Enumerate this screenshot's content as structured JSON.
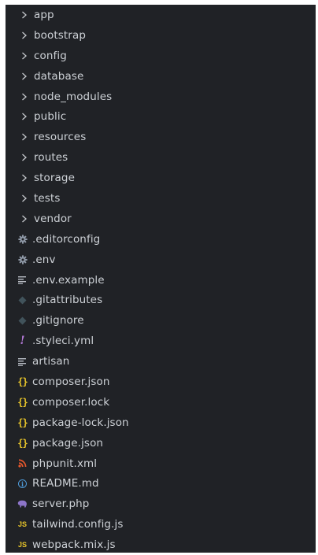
{
  "explorer": {
    "items": [
      {
        "label": "app",
        "kind": "folder",
        "icon": "chevron-right-icon"
      },
      {
        "label": "bootstrap",
        "kind": "folder",
        "icon": "chevron-right-icon"
      },
      {
        "label": "config",
        "kind": "folder",
        "icon": "chevron-right-icon"
      },
      {
        "label": "database",
        "kind": "folder",
        "icon": "chevron-right-icon"
      },
      {
        "label": "node_modules",
        "kind": "folder",
        "icon": "chevron-right-icon"
      },
      {
        "label": "public",
        "kind": "folder",
        "icon": "chevron-right-icon"
      },
      {
        "label": "resources",
        "kind": "folder",
        "icon": "chevron-right-icon"
      },
      {
        "label": "routes",
        "kind": "folder",
        "icon": "chevron-right-icon"
      },
      {
        "label": "storage",
        "kind": "folder",
        "icon": "chevron-right-icon"
      },
      {
        "label": "tests",
        "kind": "folder",
        "icon": "chevron-right-icon"
      },
      {
        "label": "vendor",
        "kind": "folder",
        "icon": "chevron-right-icon"
      },
      {
        "label": ".editorconfig",
        "kind": "file",
        "icon": "gear-icon"
      },
      {
        "label": ".env",
        "kind": "file",
        "icon": "gear-icon"
      },
      {
        "label": ".env.example",
        "kind": "file",
        "icon": "text-lines-icon"
      },
      {
        "label": ".gitattributes",
        "kind": "file",
        "icon": "git-diamond-icon"
      },
      {
        "label": ".gitignore",
        "kind": "file",
        "icon": "git-diamond-icon"
      },
      {
        "label": ".styleci.yml",
        "kind": "file",
        "icon": "yaml-exclamation-icon"
      },
      {
        "label": "artisan",
        "kind": "file",
        "icon": "text-lines-icon"
      },
      {
        "label": "composer.json",
        "kind": "file",
        "icon": "json-braces-icon"
      },
      {
        "label": "composer.lock",
        "kind": "file",
        "icon": "json-braces-icon"
      },
      {
        "label": "package-lock.json",
        "kind": "file",
        "icon": "json-braces-icon"
      },
      {
        "label": "package.json",
        "kind": "file",
        "icon": "json-braces-icon"
      },
      {
        "label": "phpunit.xml",
        "kind": "file",
        "icon": "rss-xml-icon"
      },
      {
        "label": "README.md",
        "kind": "file",
        "icon": "info-icon"
      },
      {
        "label": "server.php",
        "kind": "file",
        "icon": "php-elephant-icon"
      },
      {
        "label": "tailwind.config.js",
        "kind": "file",
        "icon": "js-icon"
      },
      {
        "label": "webpack.mix.js",
        "kind": "file",
        "icon": "js-icon"
      }
    ]
  },
  "colors": {
    "background": "#202226",
    "text": "#cdd1d6",
    "chevron": "#c5c8cc",
    "gear": "#8e98a6",
    "text-lines": "#b9bec5",
    "git-diamond": "#41535b",
    "yaml": "#b57ad9",
    "json": "#e8c52a",
    "xml": "#e8582c",
    "info": "#4f9bd9",
    "php": "#8d75c9",
    "js": "#e8c52a"
  }
}
